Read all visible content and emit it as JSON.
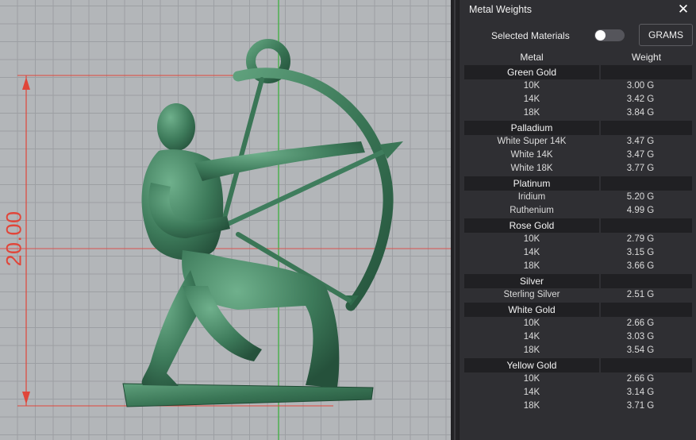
{
  "viewport": {
    "dimension_label": "20.00",
    "colors": {
      "dimension": "#e0463a",
      "model": "#3d7a5a",
      "grid_bg": "#b3b6b9"
    }
  },
  "panel": {
    "title": "Metal Weights",
    "close_icon": "close-icon",
    "selected_materials_label": "Selected Materials",
    "selected_materials_on": false,
    "units_label": "GRAMS",
    "columns": {
      "metal": "Metal",
      "weight": "Weight"
    },
    "groups": [
      {
        "name": "Green Gold",
        "rows": [
          {
            "name": "10K",
            "weight": "3.00 G"
          },
          {
            "name": "14K",
            "weight": "3.42 G"
          },
          {
            "name": "18K",
            "weight": "3.84 G"
          }
        ]
      },
      {
        "name": "Palladium",
        "rows": [
          {
            "name": "White Super 14K",
            "weight": "3.47 G"
          },
          {
            "name": "White 14K",
            "weight": "3.47 G"
          },
          {
            "name": "White 18K",
            "weight": "3.77 G"
          }
        ]
      },
      {
        "name": "Platinum",
        "rows": [
          {
            "name": "Iridium",
            "weight": "5.20 G"
          },
          {
            "name": "Ruthenium",
            "weight": "4.99 G"
          }
        ]
      },
      {
        "name": "Rose Gold",
        "rows": [
          {
            "name": "10K",
            "weight": "2.79 G"
          },
          {
            "name": "14K",
            "weight": "3.15 G"
          },
          {
            "name": "18K",
            "weight": "3.66 G"
          }
        ]
      },
      {
        "name": "Silver",
        "rows": [
          {
            "name": "Sterling Silver",
            "weight": "2.51 G"
          }
        ]
      },
      {
        "name": "White Gold",
        "rows": [
          {
            "name": "10K",
            "weight": "2.66 G"
          },
          {
            "name": "14K",
            "weight": "3.03 G"
          },
          {
            "name": "18K",
            "weight": "3.54 G"
          }
        ]
      },
      {
        "name": "Yellow Gold",
        "rows": [
          {
            "name": "10K",
            "weight": "2.66 G"
          },
          {
            "name": "14K",
            "weight": "3.14 G"
          },
          {
            "name": "18K",
            "weight": "3.71 G"
          }
        ]
      }
    ]
  }
}
